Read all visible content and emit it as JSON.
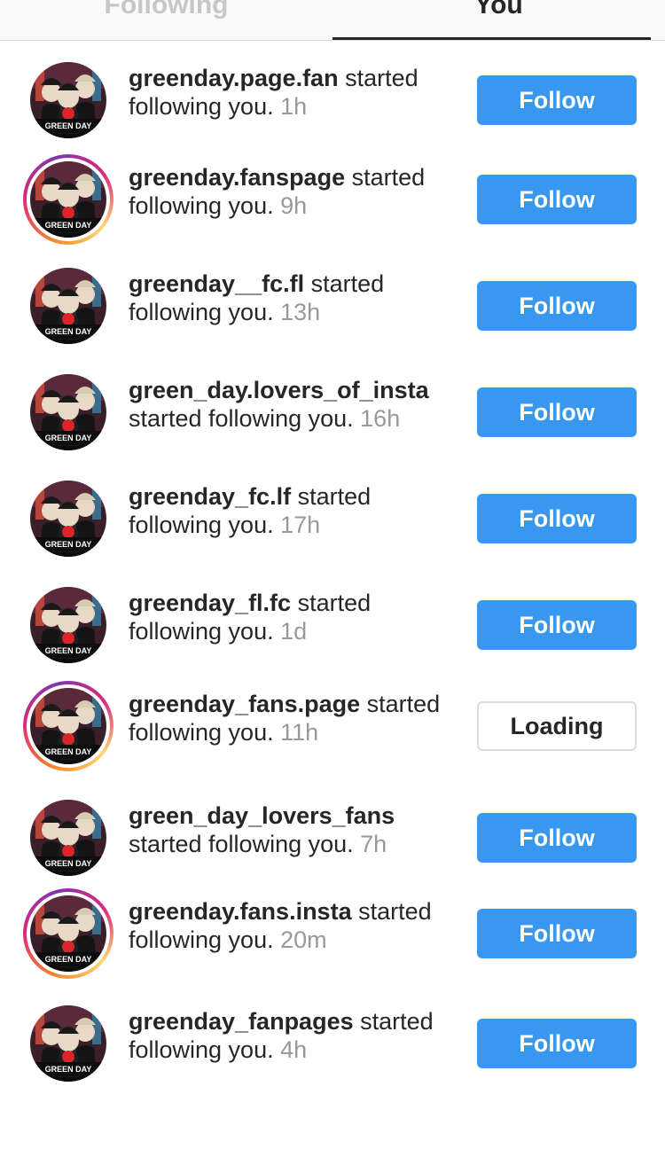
{
  "tabs": {
    "following": "Following",
    "you": "You"
  },
  "notifications": [
    {
      "username": "greenday.page.fan",
      "action": " started following you.",
      "time": "1h",
      "button": "Follow",
      "story": false
    },
    {
      "username": "greenday.fanspage",
      "action": " started following you.",
      "time": "9h",
      "button": "Follow",
      "story": true
    },
    {
      "username": "greenday__fc.fl",
      "action": " started following you.",
      "time": "13h",
      "button": "Follow",
      "story": false
    },
    {
      "username": "green_day.lovers_of_insta",
      "action": " started following you.",
      "time": "16h",
      "button": "Follow",
      "story": false
    },
    {
      "username": "greenday_fc.lf",
      "action": " started following you.",
      "time": "17h",
      "button": "Follow",
      "story": false
    },
    {
      "username": "greenday_fl.fc",
      "action": " started following you.",
      "time": "1d",
      "button": "Follow",
      "story": false
    },
    {
      "username": "greenday_fans.page",
      "action": " started following you.",
      "time": "11h",
      "button": "Loading",
      "story": true
    },
    {
      "username": "green_day_lovers_fans",
      "action": " started following you.",
      "time": "7h",
      "button": "Follow",
      "story": false
    },
    {
      "username": "greenday.fans.insta",
      "action": " started following you.",
      "time": "20m",
      "button": "Follow",
      "story": true
    },
    {
      "username": "greenday_fanpages",
      "action": " started following you.",
      "time": "4h",
      "button": "Follow",
      "story": false
    }
  ],
  "avatar_label": "GREEN DAY",
  "colors": {
    "follow_blue": "#3897f0",
    "timestamp_gray": "#999999",
    "story_ring": "#dd2a7b"
  }
}
